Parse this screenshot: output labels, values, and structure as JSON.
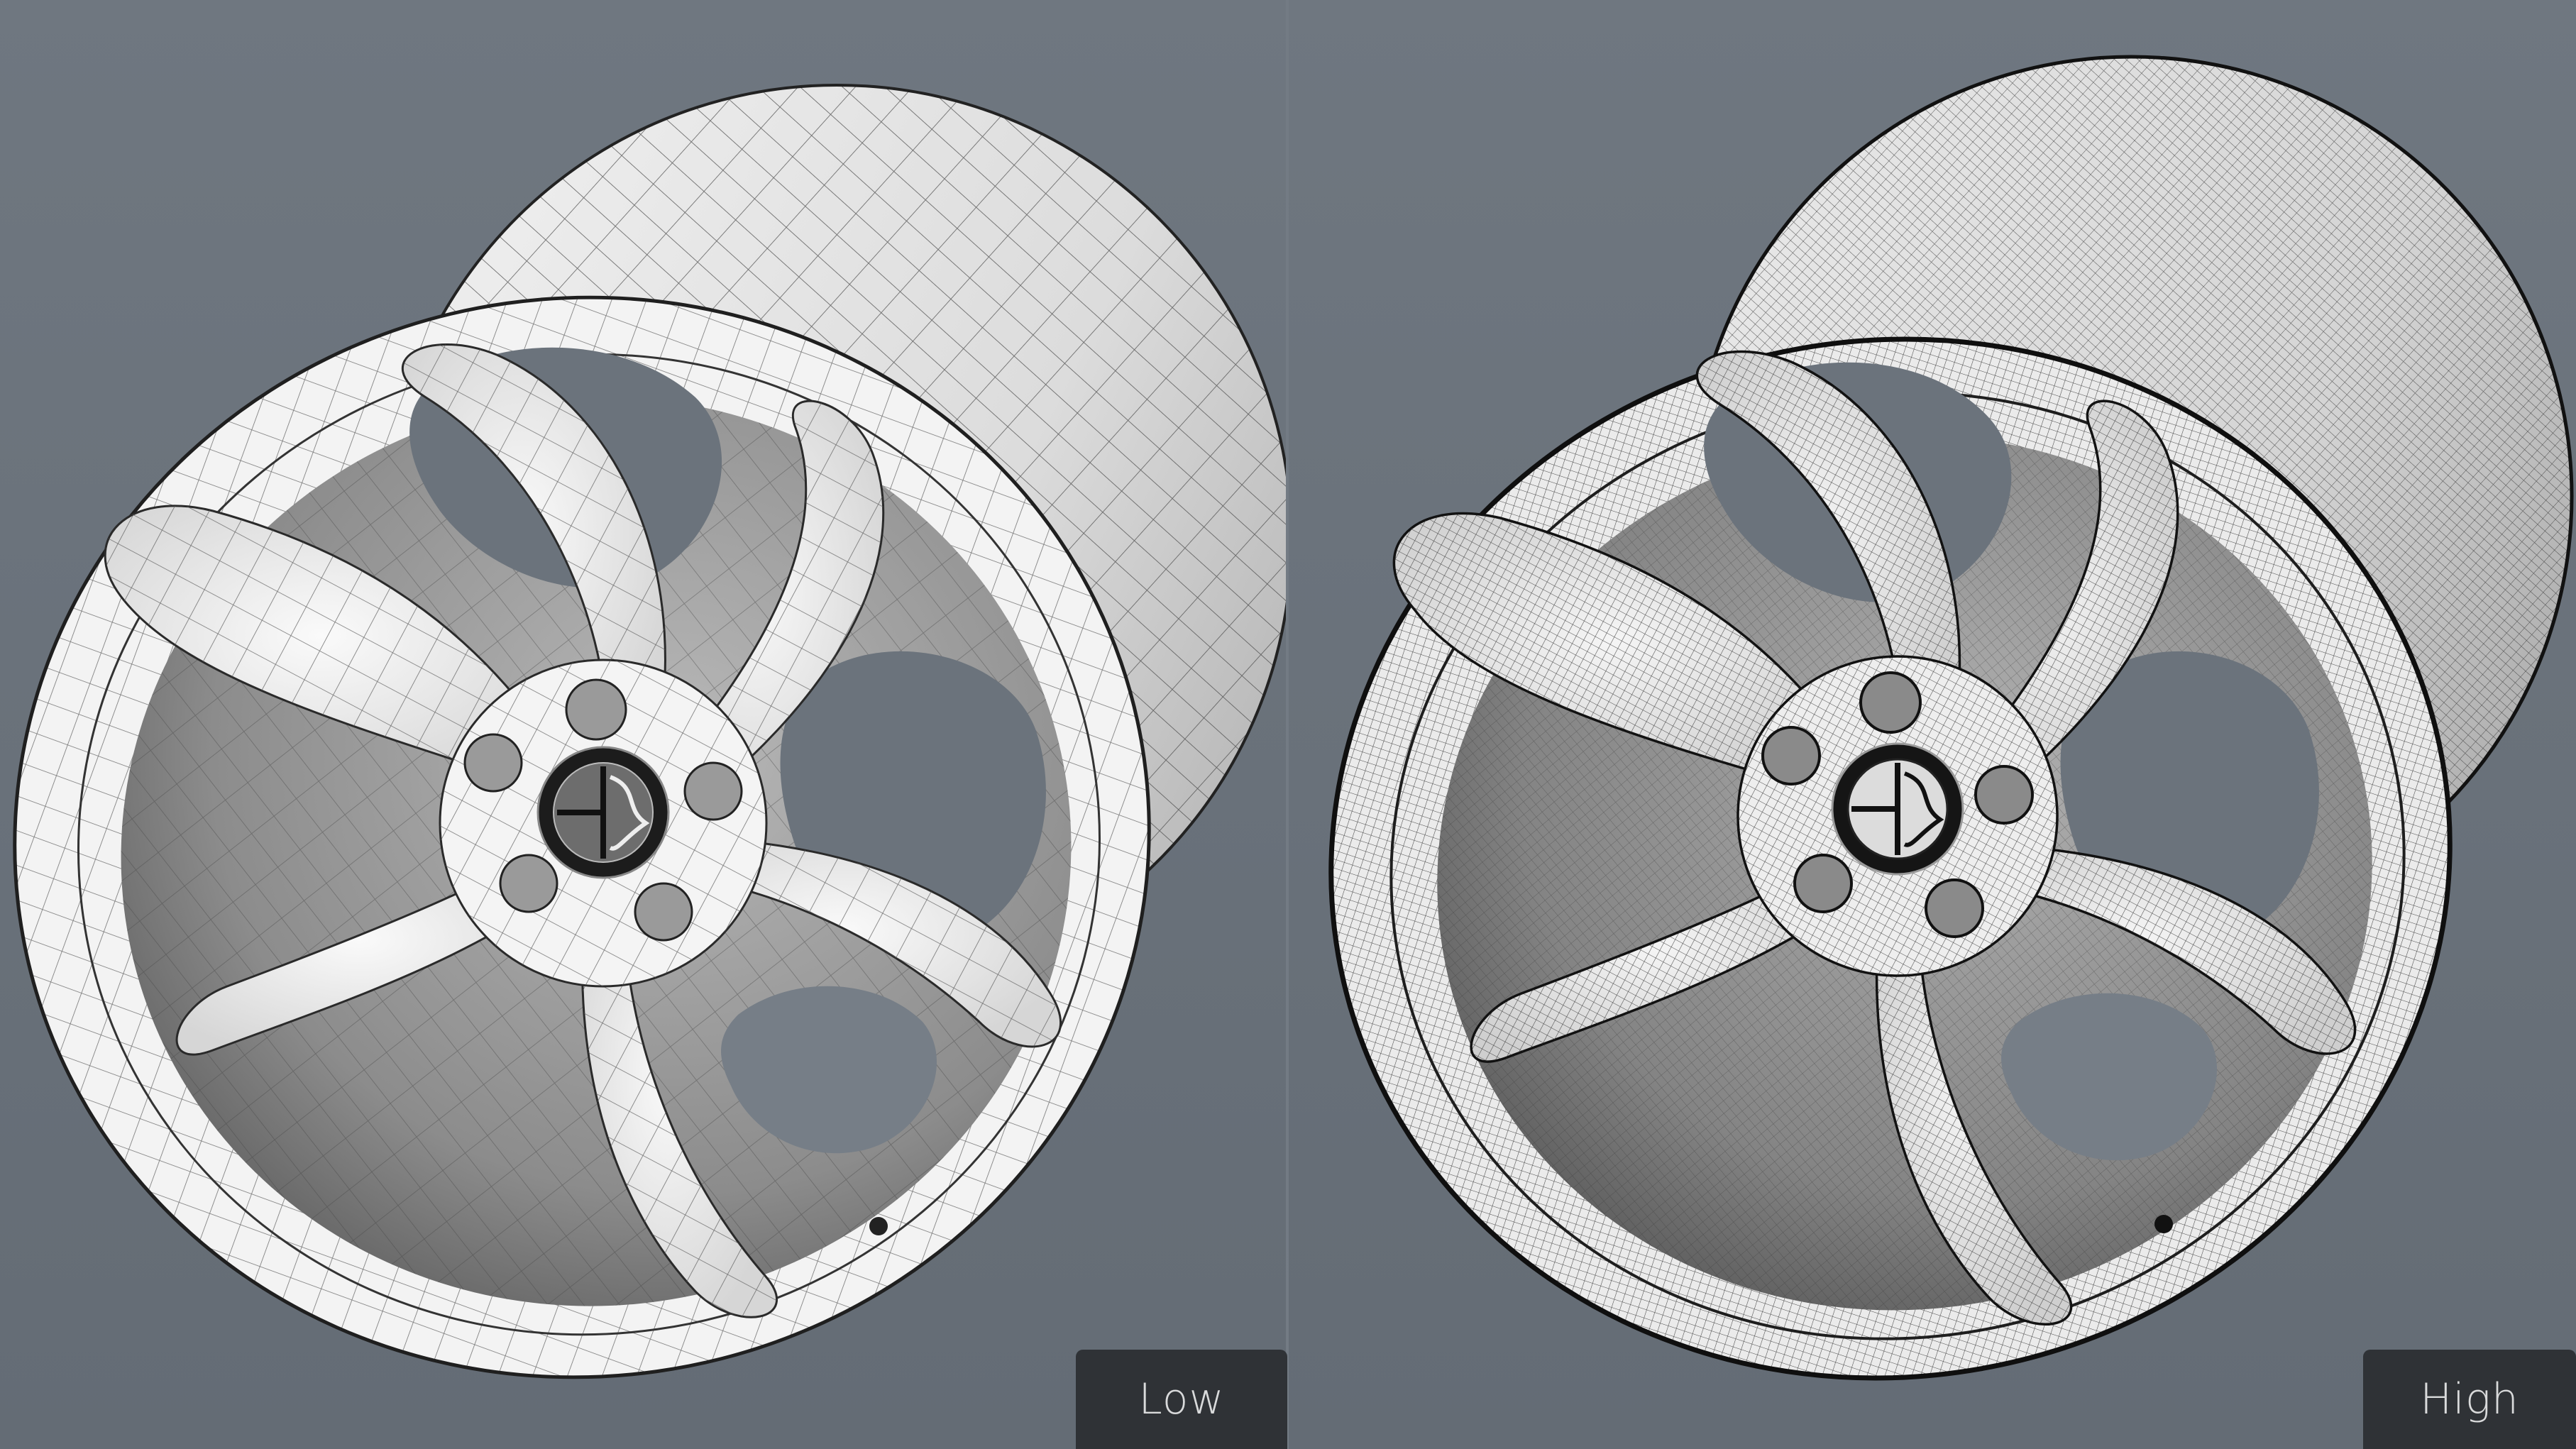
{
  "panels": {
    "left": {
      "label": "Low",
      "wheel_surface_color": "#eeeeee",
      "wire_color": "#5a5a5a"
    },
    "right": {
      "label": "High",
      "wheel_surface_color": "#e6e6e6",
      "wire_color": "#2e2e2e"
    }
  },
  "colors": {
    "background": "#6b737c",
    "label_tab": "#2f3236",
    "label_text": "#d9dadb"
  },
  "icons": {
    "center_cap": "alfa-romeo-logo"
  }
}
